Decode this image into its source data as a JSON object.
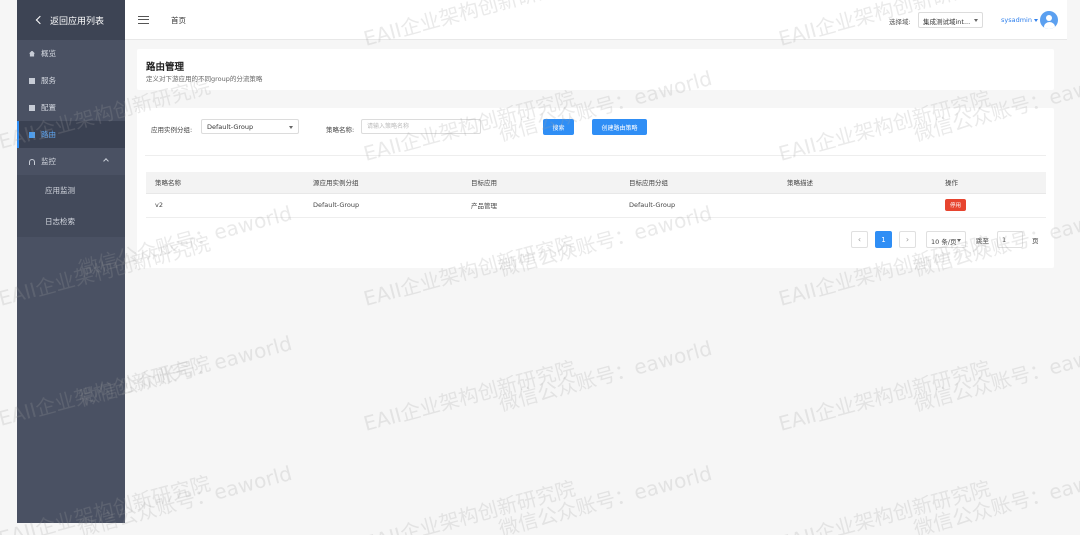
{
  "sidebar": {
    "back_label": "返回应用列表",
    "items": [
      {
        "label": "概览",
        "icon": "home-icon"
      },
      {
        "label": "服务",
        "icon": "square-icon"
      },
      {
        "label": "配置",
        "icon": "square-icon"
      },
      {
        "label": "路由",
        "icon": "square-icon",
        "active": true
      },
      {
        "label": "监控",
        "icon": "monitor-icon",
        "expanded": true
      }
    ],
    "sub_items": [
      {
        "label": "应用监测"
      },
      {
        "label": "日志检索"
      }
    ]
  },
  "topbar": {
    "breadcrumb": "首页",
    "domain_label": "选择域:",
    "domain_value": "集成测试域int...",
    "username": "sysadmin"
  },
  "header": {
    "title": "路由管理",
    "description": "定义对下游应用的不同group的分流策略"
  },
  "filters": {
    "group_label": "应用实例分组:",
    "group_value": "Default-Group",
    "name_label": "策略名称:",
    "name_placeholder": "请输入策略名称",
    "search_button": "搜索",
    "create_button": "创建路由策略"
  },
  "table": {
    "columns": [
      "策略名称",
      "源应用实例分组",
      "目标应用",
      "目标应用分组",
      "策略描述",
      "操作"
    ],
    "rows": [
      {
        "name": "v2",
        "source_group": "Default-Group",
        "target_app": "产品管理",
        "target_group": "Default-Group",
        "description": "",
        "action": "停用"
      }
    ]
  },
  "pagination": {
    "current_page": "1",
    "page_size": "10 条/页",
    "goto_label": "跳至",
    "goto_value": "1",
    "page_suffix": "页"
  },
  "watermark": {
    "line1": "EAII企业架构创新研究院",
    "line2": "微信公众账号：eaworld"
  },
  "colors": {
    "sidebar_bg": "#4a5163",
    "primary": "#2f8ef5",
    "danger": "#e7442f"
  }
}
